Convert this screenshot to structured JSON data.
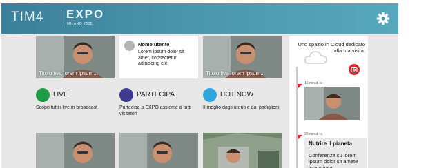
{
  "header": {
    "brand": "TIM4",
    "expo": "EXPO",
    "expo_sub": "MILANO 2015",
    "settings_icon": "gear-icon"
  },
  "cards": {
    "live_caption_1": "Titolo live lorem ipsum...",
    "live_caption_2": "Titolo live lorem ipsum..."
  },
  "user_card": {
    "name": "Nome utente",
    "text": "Lorem ipsum dolor sit amet, consectetur adipiscing elit"
  },
  "categories": [
    {
      "title": "LIVE",
      "desc": "Scopri tutti i live in broadcast",
      "color": "#1f9a47"
    },
    {
      "title": "PARTECIPA",
      "desc": "Partecipa a EXPO assieme a tutti i visitatori",
      "color": "#3f3a8f"
    },
    {
      "title": "HOT NOW",
      "desc": "Il meglio dagli utenti e dai padiglioni",
      "color": "#2ea6dd"
    }
  ],
  "timeline": {
    "intro": "Uno spazio in Cloud dedicato alla tua visita.",
    "camera_icon": "camera-icon",
    "items": [
      {
        "time": "15 minuti fa"
      },
      {
        "time": "20 minuti fa",
        "title": "Nutrire il pianeta",
        "body": "Conferenza su lorem ipsum dolor sit amete lorem ipsu"
      }
    ]
  },
  "colors": {
    "header": "#4a97ad",
    "accent_red": "#e0242b",
    "background": "#e7e7e7"
  }
}
